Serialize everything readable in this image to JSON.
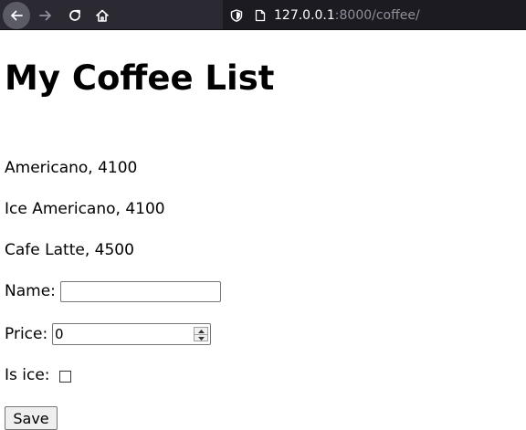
{
  "browser": {
    "url_host": "127.0.0.1",
    "url_rest": ":8000/coffee/",
    "icons": [
      "back-arrow-icon",
      "forward-arrow-icon",
      "reload-icon",
      "home-icon",
      "shield-icon",
      "page-icon"
    ]
  },
  "page": {
    "title": "My Coffee List",
    "items": [
      "Americano, 4100",
      "Ice Americano, 4100",
      "Cafe Latte, 4500"
    ]
  },
  "form": {
    "name_label": "Name:",
    "name_value": "",
    "price_label": "Price:",
    "price_value": "0",
    "ice_label": "Is ice:",
    "ice_checked": false,
    "save_label": "Save"
  }
}
